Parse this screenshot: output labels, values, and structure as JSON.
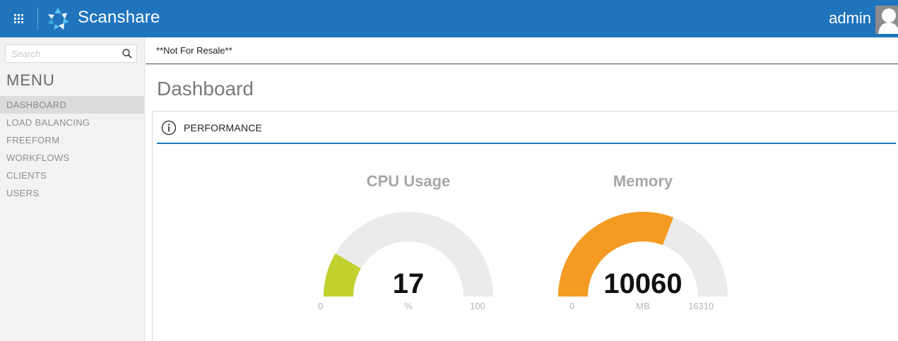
{
  "app": {
    "brand": "Scanshare",
    "user": "admin"
  },
  "colors": {
    "header_bg": "#1f74bc",
    "cpu_fill": "#c2d12e",
    "memory_fill": "#f49b23",
    "gauge_track": "#ebebeb"
  },
  "sidebar": {
    "search_placeholder": "Search",
    "menu_title": "MENU",
    "items": [
      {
        "label": "DASHBOARD",
        "active": true
      },
      {
        "label": "LOAD BALANCING",
        "active": false
      },
      {
        "label": "FREEFORM",
        "active": false
      },
      {
        "label": "WORKFLOWS",
        "active": false
      },
      {
        "label": "CLIENTS",
        "active": false
      },
      {
        "label": "USERS",
        "active": false
      }
    ]
  },
  "main": {
    "notice": "**Not For Resale**",
    "page_title": "Dashboard",
    "panel": {
      "title": "PERFORMANCE",
      "icon": "info-icon"
    },
    "gauges": [
      {
        "title": "CPU Usage",
        "value": 17,
        "display_value": "17",
        "unit": "%",
        "min": 0,
        "max": 100,
        "min_label": "0",
        "max_label": "100",
        "color": "#c2d12e"
      },
      {
        "title": "Memory",
        "value": 10060,
        "display_value": "10060",
        "unit": "MB",
        "min": 0,
        "max": 16310,
        "min_label": "0",
        "max_label": "16310",
        "color": "#f49b23"
      }
    ]
  }
}
